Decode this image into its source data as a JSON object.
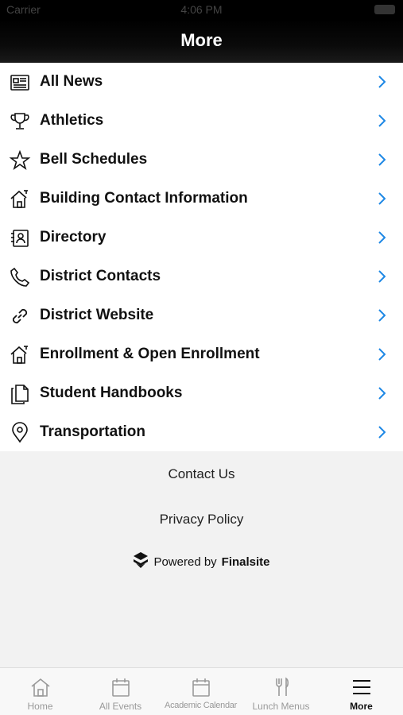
{
  "status_bar": {
    "carrier": "Carrier",
    "time": "4:06 PM"
  },
  "nav": {
    "title": "More"
  },
  "menu": [
    {
      "label": "All News",
      "icon": "newspaper-icon"
    },
    {
      "label": "Athletics",
      "icon": "trophy-icon"
    },
    {
      "label": "Bell Schedules",
      "icon": "star-icon"
    },
    {
      "label": "Building Contact Information",
      "icon": "house-icon"
    },
    {
      "label": "Directory",
      "icon": "contact-card-icon"
    },
    {
      "label": "District Contacts",
      "icon": "phone-icon"
    },
    {
      "label": "District Website",
      "icon": "link-icon"
    },
    {
      "label": "Enrollment & Open Enrollment",
      "icon": "house-icon"
    },
    {
      "label": "Student Handbooks",
      "icon": "documents-icon"
    },
    {
      "label": "Transportation",
      "icon": "map-pin-icon"
    }
  ],
  "footer": {
    "contact_us": "Contact Us",
    "privacy_policy": "Privacy Policy",
    "powered_by": "Powered by",
    "brand": "Finalsite"
  },
  "tabs": [
    {
      "label": "Home",
      "icon": "home-icon"
    },
    {
      "label": "All Events",
      "icon": "calendar-icon"
    },
    {
      "label": "Academic Calendar",
      "icon": "calendar-icon"
    },
    {
      "label": "Lunch Menus",
      "icon": "fork-knife-icon"
    },
    {
      "label": "More",
      "icon": "hamburger-menu-icon"
    }
  ],
  "colors": {
    "accent": "#1e88e5",
    "nav_bg": "#000000",
    "active_tab": "#111111",
    "inactive_tab": "#999999"
  }
}
